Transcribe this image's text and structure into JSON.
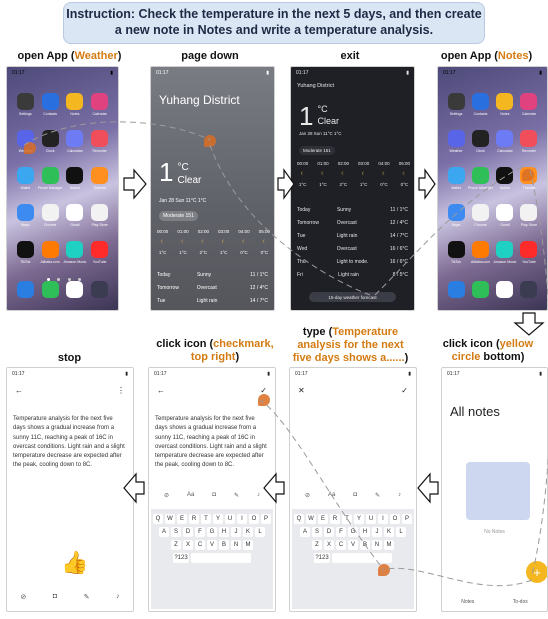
{
  "instruction": "Instruction: Check the temperature in the next 5 days, and then create a new note in Notes and write a temperature analysis.",
  "steps": {
    "s1": {
      "prefix": "open App (",
      "app": "Weather",
      "suffix": ")"
    },
    "s2": {
      "label": "page down"
    },
    "s3": {
      "label": "exit"
    },
    "s4": {
      "prefix": "open App (",
      "app": "Notes",
      "suffix": ")"
    },
    "s5": {
      "prefix": "click icon (",
      "hl": "yellow circle",
      "suffix": " bottom)"
    },
    "s6": {
      "prefix": "type (",
      "hl": "Temperature analysis for the next five days shows a......",
      "suffix": ")"
    },
    "s7": {
      "prefix": "click icon (",
      "hl": "checkmark, top right",
      "suffix": ")"
    },
    "s8": {
      "label": "stop"
    }
  },
  "weather": {
    "district": "Yuhang District",
    "temp": "1",
    "unit": "°C",
    "condition": "Clear",
    "date_line": "Jan 28 Sun  11°C  1°C",
    "aqi": "Moderate 151",
    "hours": [
      "00:00",
      "01:00",
      "02:00",
      "03:00",
      "04:00",
      "05:00"
    ],
    "hour_temps": [
      "1°C",
      "1°C",
      "2°C",
      "1°C",
      "0°C",
      "0°C"
    ],
    "forecast": [
      {
        "day": "Today",
        "cond": "Sunny",
        "range": "11 / 1°C"
      },
      {
        "day": "Tomorrow",
        "cond": "Overcast",
        "range": "12 / 4°C"
      },
      {
        "day": "Tue",
        "cond": "Light rain",
        "range": "14 / 7°C"
      },
      {
        "day": "Wed",
        "cond": "Overcast",
        "range": "16 / 6°C"
      },
      {
        "day": "Thu",
        "cond": "Light to mode.",
        "range": "16 / 6°C"
      },
      {
        "day": "Fri",
        "cond": "Light rain",
        "range": "8 / 5°C"
      }
    ],
    "forecast_button": "15-day weather forecast"
  },
  "notes": {
    "all_notes": "All notes",
    "no_notes": "No Notes",
    "tab_notes": "Notes",
    "tab_todo": "To-dos",
    "note_body": "Temperature analysis for the next five days shows a gradual increase from a sunny 11C, reaching a peak of 16C in overcast conditions. Light rain and a slight temperature decrease are expected after the peak, cooling down to 8C.",
    "format_aa": "Aa"
  },
  "home_apps": [
    "Settings",
    "Contacts",
    "Notes",
    "Calendar",
    "Weather",
    "Clock",
    "Calculator",
    "Recorder",
    "Wallet",
    "Phone Manager",
    "Notion",
    "Themes",
    "Maps",
    "Chrome",
    "Gmail",
    "Play Store",
    "TikTok",
    "Alibaba.com",
    "Amazon Music",
    "YouTube"
  ],
  "keyboard": {
    "row1": [
      "Q",
      "W",
      "E",
      "R",
      "T",
      "Y",
      "U",
      "I",
      "O",
      "P"
    ],
    "row2": [
      "A",
      "S",
      "D",
      "F",
      "G",
      "H",
      "J",
      "K",
      "L"
    ],
    "row3": [
      "Z",
      "X",
      "C",
      "V",
      "B",
      "N",
      "M"
    ],
    "num": "?123"
  },
  "status_time": "01:17"
}
